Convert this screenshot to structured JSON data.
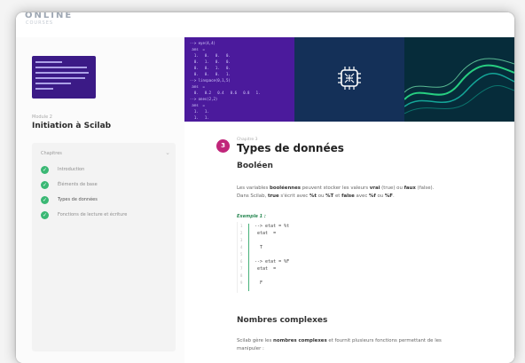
{
  "brand": {
    "name": "ONLINE",
    "sub": "COURSES"
  },
  "sidebar": {
    "module_label": "Module 2",
    "module_title": "Initiation à Scilab",
    "chapters_title": "Chapitres",
    "items": [
      {
        "label": "Introduction",
        "done": true
      },
      {
        "label": "Éléments de base",
        "done": true
      },
      {
        "label": "Types de données",
        "done": true
      },
      {
        "label": "Fonctions de lecture et écriture",
        "done": true
      }
    ]
  },
  "chapter": {
    "number": "3",
    "label": "Chapitre 3",
    "title": "Types de données"
  },
  "sections": {
    "boolean_heading": "Booléen",
    "boolean_text_1_pre": "Les variables ",
    "boolean_text_1_bold": "booléennes",
    "boolean_text_1_mid": " peuvent stocker les valeurs ",
    "boolean_text_1_vrai": "vrai",
    "boolean_text_1_mid2": " (true) ou ",
    "boolean_text_1_faux": "faux",
    "boolean_text_1_post": " (false).",
    "boolean_text_2_pre": "Dans Scilab, ",
    "boolean_text_2_true": "true",
    "boolean_text_2_mid": " s'écrit avec ",
    "boolean_text_2_t1": "%t",
    "boolean_text_2_ou1": " ou ",
    "boolean_text_2_t2": "%T",
    "boolean_text_2_and": " et ",
    "boolean_text_2_false": "false",
    "boolean_text_2_mid3": " avec ",
    "boolean_text_2_f1": "%f",
    "boolean_text_2_ou2": " ou ",
    "boolean_text_2_f2": "%F",
    "boolean_text_2_end": ".",
    "example_label": "Exemple 1 :",
    "code_lines": [
      "--> etat = %t",
      " etat  =",
      "",
      "  T",
      "",
      "--> etat = %F",
      " etat  =",
      "",
      "  F"
    ],
    "code_numbers": [
      "1",
      "2",
      "3",
      "4",
      "5",
      "6",
      "7",
      "8",
      "9"
    ],
    "complex_heading": "Nombres complexes",
    "complex_text_1_pre": "Scilab gère les ",
    "complex_text_1_bold": "nombres complexes",
    "complex_text_1_post": " et fournit plusieurs fonctions permettant de les",
    "complex_text_2": "manipuler :"
  },
  "hero_code": [
    "--> eye(4,4)",
    " ans  =",
    "  1.   0.   0.   0.",
    "  0.   1.   0.   0.",
    "  0.   0.   1.   0.",
    "  0.   0.   0.   1.",
    "--> linspace(0,1,5)",
    " ans  =",
    "  0.   0.2   0.4   0.6   0.8   1.",
    "--> ones(2,2)",
    " ans  =",
    "  1.   1.",
    "  1.   1."
  ],
  "colors": {
    "accent": "#c0257a",
    "check": "#3ab874",
    "hero_purple": "#4b1a9c"
  }
}
